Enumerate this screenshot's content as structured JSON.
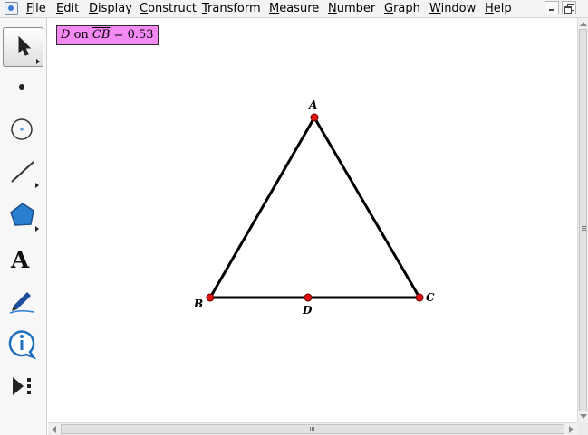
{
  "menu": {
    "items": [
      "File",
      "Edit",
      "Display",
      "Construct",
      "Transform",
      "Measure",
      "Number",
      "Graph",
      "Window",
      "Help"
    ],
    "mnemonics": [
      "F",
      "E",
      "D",
      "C",
      "T",
      "M",
      "N",
      "G",
      "W",
      "H"
    ]
  },
  "toolbox": {
    "tools": [
      "arrow-tool",
      "point-tool",
      "compass-tool",
      "straightedge-tool",
      "polygon-tool",
      "text-tool",
      "marker-tool",
      "information-tool",
      "custom-tool"
    ],
    "selected": "arrow-tool",
    "text_tool_glyph": "A"
  },
  "measurement": {
    "point": "D",
    "on_word": "on",
    "segment": "CB",
    "equals": "=",
    "value": "0.53"
  },
  "points": {
    "A": "A",
    "B": "B",
    "C": "C",
    "D": "D"
  },
  "colors": {
    "measurement_bg": "#f389f3",
    "point_fill": "#e01010",
    "segment_stroke": "#000000"
  }
}
